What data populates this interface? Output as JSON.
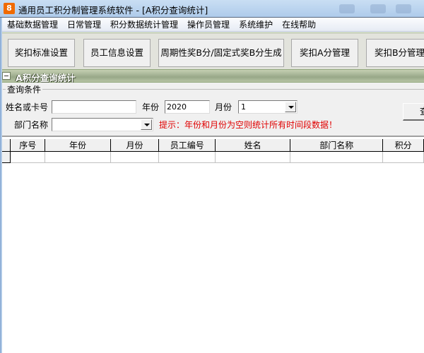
{
  "window": {
    "app_icon_glyph": "8",
    "title": "通用员工积分制管理系统软件   - [A积分查询统计]"
  },
  "menubar": {
    "items": [
      {
        "label": "基础数据管理"
      },
      {
        "label": "日常管理"
      },
      {
        "label": "积分数据统计管理"
      },
      {
        "label": "操作员管理"
      },
      {
        "label": "系统维护"
      },
      {
        "label": "在线帮助"
      }
    ]
  },
  "toolbar": {
    "buttons": [
      {
        "label": "奖扣标准设置"
      },
      {
        "label": "员工信息设置"
      },
      {
        "label": "周期性奖B分/固定式奖B分生成"
      },
      {
        "label": "奖扣A分管理"
      },
      {
        "label": "奖扣B分管理"
      }
    ]
  },
  "panel": {
    "title": "A积分查询统计",
    "collapse_icon": "minus-icon"
  },
  "query": {
    "group_title": "查询条件",
    "name_or_card_label": "姓名或卡号",
    "name_or_card_value": "",
    "year_label": "年份",
    "year_value": "2020",
    "month_label": "月份",
    "month_value": "1",
    "department_label": "部门名称",
    "department_value": "",
    "hint": "提示：年份和月份为空则统计所有时间段数据！",
    "query_button_label": "查询",
    "hint_color": "#e00000"
  },
  "grid": {
    "columns": [
      "序号",
      "年份",
      "月份",
      "员工编号",
      "姓名",
      "部门名称",
      "积分"
    ],
    "rows": [
      [
        "",
        "",
        "",
        "",
        "",
        "",
        ""
      ]
    ]
  }
}
